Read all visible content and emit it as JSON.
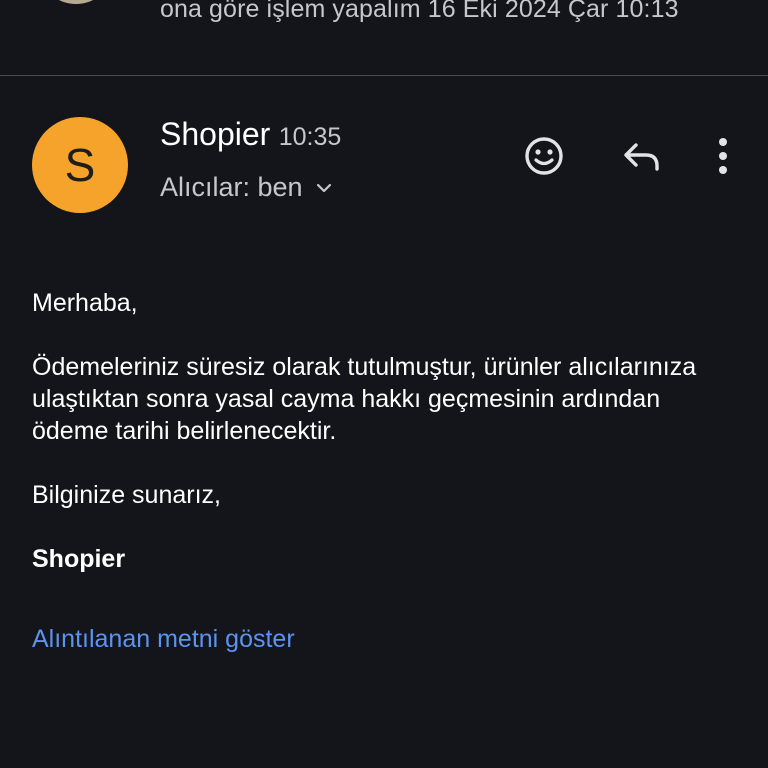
{
  "previous_message": {
    "snippet": "ona göre işlem yapalım 16 Eki 2024 Çar 10:13"
  },
  "message": {
    "avatar_letter": "S",
    "sender": "Shopier",
    "time": "10:35",
    "recipients": "Alıcılar: ben",
    "body": {
      "greeting": "Merhaba,",
      "paragraph": "Ödemeleriniz süresiz olarak tutulmuştur, ürünler alıcılarınıza ulaştıktan sonra yasal cayma hakkı geçmesinin ardından ödeme tarihi belirlenecektir.",
      "closing": "Bilginize sunarız,",
      "signature": "Shopier"
    },
    "show_quoted_link": "Alıntılanan metni göster"
  },
  "icons": {
    "emoji": "smiley-icon",
    "reply": "reply-icon",
    "more": "more-vert-icon",
    "recipients_toggle": "chevron-down-icon"
  },
  "colors": {
    "background": "#14151a",
    "avatar": "#f5a32a",
    "link": "#5a94f0",
    "secondary_text": "#c6c7cc"
  }
}
